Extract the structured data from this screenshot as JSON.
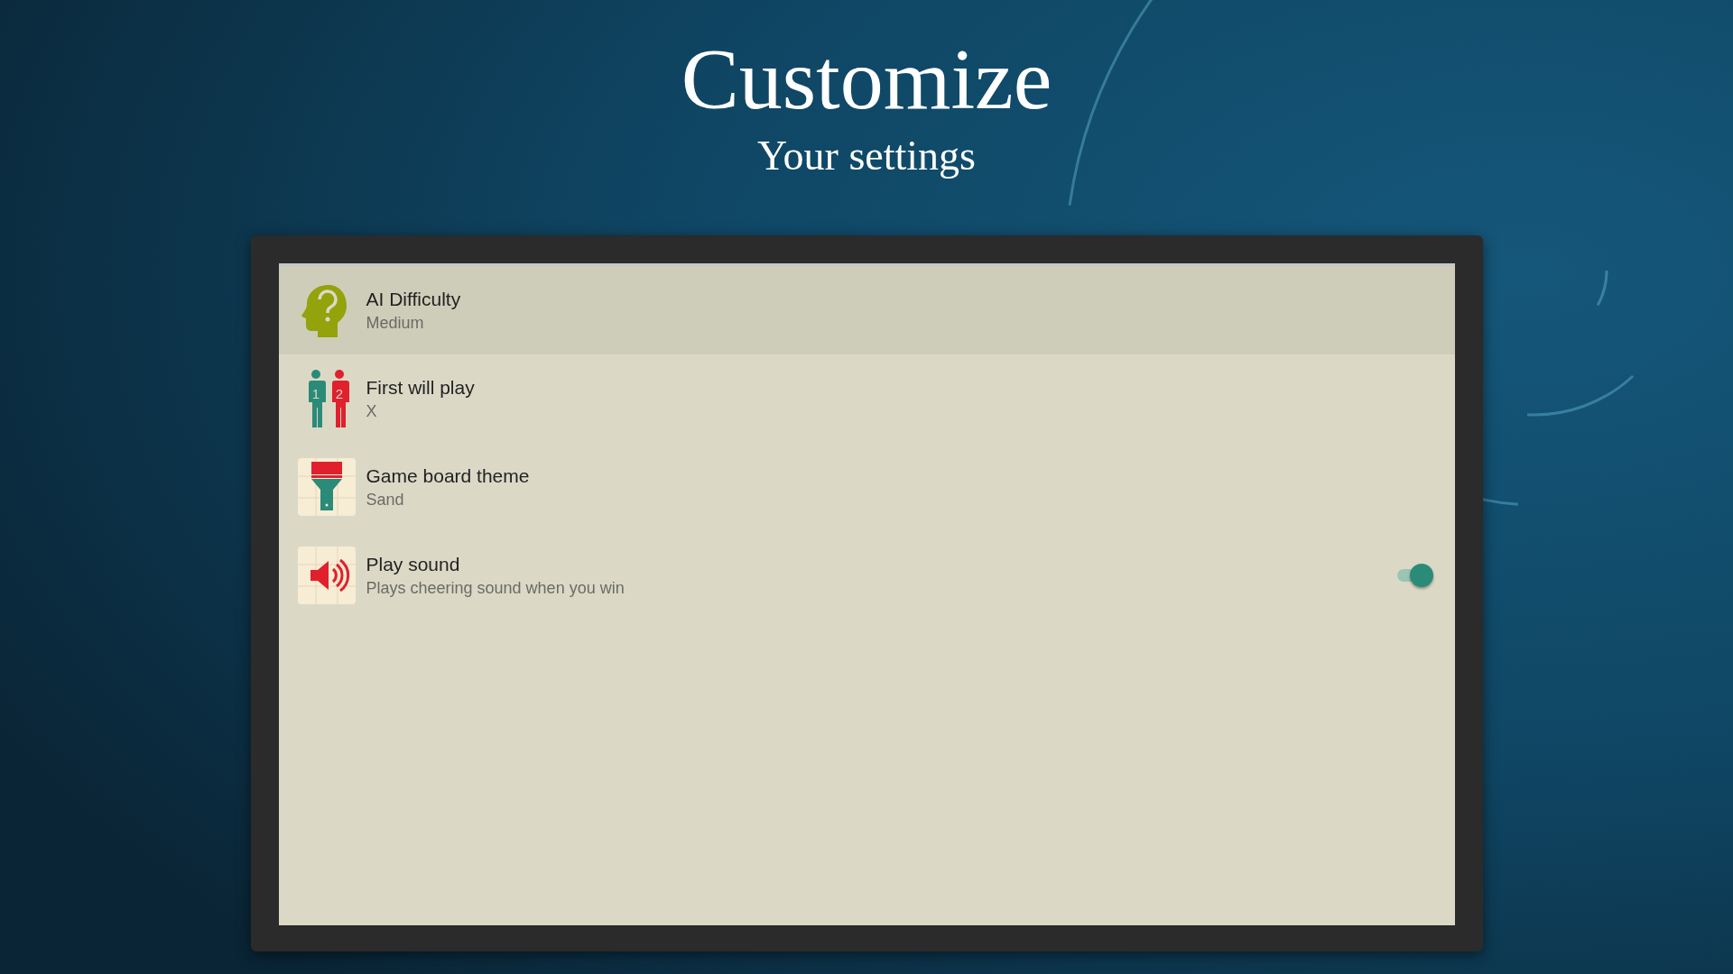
{
  "header": {
    "title": "Customize",
    "subtitle": "Your settings"
  },
  "settings": [
    {
      "kind": "plain",
      "title": "AI Difficulty",
      "subtitle": "Medium",
      "selected": true
    },
    {
      "kind": "plain",
      "icon_labels": [
        "1",
        "2"
      ],
      "title": "First will play",
      "subtitle": "X",
      "selected": false
    },
    {
      "kind": "plain",
      "title": "Game board theme",
      "subtitle": "Sand",
      "selected": false
    },
    {
      "kind": "toggle",
      "title": "Play sound",
      "subtitle": "Plays cheering sound when you win",
      "selected": false,
      "on": true
    }
  ]
}
